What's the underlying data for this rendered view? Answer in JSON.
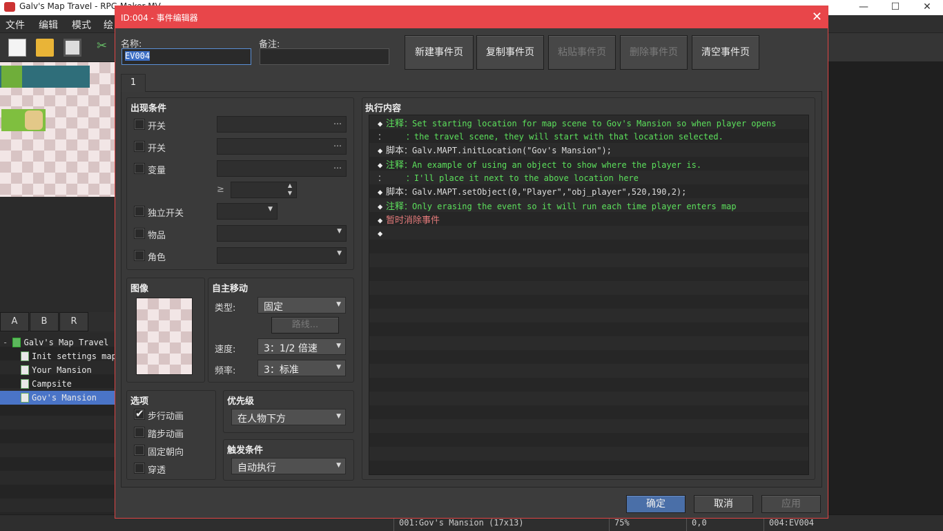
{
  "window": {
    "title": "Galv's Map Travel - RPG Maker MV"
  },
  "menu": [
    "文件",
    "编辑",
    "模式",
    "绘"
  ],
  "map_tabs": [
    "A",
    "B",
    "R"
  ],
  "map_tree": [
    {
      "label": "Galv's Map Travel",
      "root": true
    },
    {
      "label": "Init settings map"
    },
    {
      "label": "Your Mansion"
    },
    {
      "label": "Campsite"
    },
    {
      "label": "Gov's Mansion",
      "selected": true
    }
  ],
  "status": {
    "map": "001:Gov's Mansion (17x13)",
    "zoom": "75%",
    "coord": "0,0",
    "event": "004:EV004"
  },
  "dialog": {
    "title": "ID:004 - 事件编辑器",
    "close": "✕",
    "name_label": "名称:",
    "name_value": "EV004",
    "note_label": "备注:",
    "note_value": "",
    "page_buttons": {
      "new": "新建事件页",
      "copy": "复制事件页",
      "paste": "粘贴事件页",
      "delete": "删除事件页",
      "clear": "清空事件页"
    },
    "page_tab": "1",
    "conditions": {
      "title": "出现条件",
      "switch1": "开关",
      "switch2": "开关",
      "variable": "变量",
      "gte": "≥",
      "self_switch": "独立开关",
      "item": "物品",
      "actor": "角色",
      "ellipsis": "…"
    },
    "image": {
      "title": "图像"
    },
    "autonomous": {
      "title": "自主移动",
      "type_label": "类型:",
      "type_value": "固定",
      "route_button": "路线...",
      "speed_label": "速度:",
      "speed_value": "3：1/2 倍速",
      "freq_label": "频率:",
      "freq_value": "3：标准"
    },
    "options": {
      "title": "选项",
      "walking": "步行动画",
      "stepping": "踏步动画",
      "direction_fix": "固定朝向",
      "through": "穿透",
      "walking_checked": true
    },
    "priority": {
      "title": "优先级",
      "value": "在人物下方"
    },
    "trigger": {
      "title": "触发条件",
      "value": "自动执行"
    },
    "contents": {
      "title": "执行内容",
      "lines": [
        {
          "mark": "◆",
          "kw": "注释",
          "text": "：Set starting location for map scene to Gov's Mansion so when player opens",
          "color": "green"
        },
        {
          "mark": "：",
          "kw": "",
          "text": "    ：the travel scene, they will start with that location selected.",
          "color": "green"
        },
        {
          "mark": "◆",
          "kw": "脚本",
          "text": "：Galv.MAPT.initLocation(\"Gov's Mansion\");",
          "color": "white"
        },
        {
          "mark": "◆",
          "kw": "注释",
          "text": "：An example of using an object to show where the player is.",
          "color": "green"
        },
        {
          "mark": "：",
          "kw": "",
          "text": "    ：I'll place it next to the above location here",
          "color": "green"
        },
        {
          "mark": "◆",
          "kw": "脚本",
          "text": "：Galv.MAPT.setObject(0,\"Player\",\"obj_player\",520,190,2);",
          "color": "white"
        },
        {
          "mark": "◆",
          "kw": "注释",
          "text": "：Only erasing the event so it will run each time player enters map",
          "color": "green"
        },
        {
          "mark": "◆",
          "kw": "暂时消除事件",
          "text": "",
          "color": "red"
        },
        {
          "mark": "◆",
          "kw": "",
          "text": "",
          "color": "white"
        }
      ]
    },
    "footer": {
      "ok": "确定",
      "cancel": "取消",
      "apply": "应用"
    }
  }
}
